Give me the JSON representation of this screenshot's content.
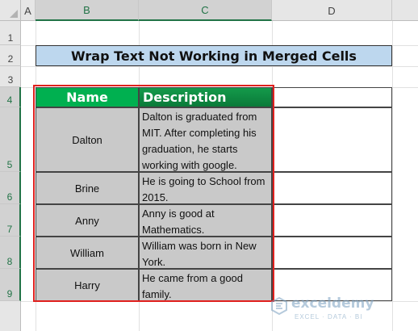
{
  "columns": [
    "A",
    "B",
    "C",
    "D"
  ],
  "rows": [
    "1",
    "2",
    "3",
    "4",
    "5",
    "6",
    "7",
    "8",
    "9"
  ],
  "title": "Wrap Text Not Working in Merged Cells",
  "table": {
    "headers": {
      "name": "Name",
      "description": "Description"
    },
    "rows": [
      {
        "name": "Dalton",
        "description": "Dalton is graduated from MIT. After completing his graduation, he starts working with google."
      },
      {
        "name": "Brine",
        "description": "He is going to School from 2015."
      },
      {
        "name": "Anny",
        "description": "Anny is good at Mathematics."
      },
      {
        "name": "William",
        "description": "William was born in New York."
      },
      {
        "name": "Harry",
        "description": "He came from a good family."
      }
    ]
  },
  "watermark": {
    "brand": "exceldemy",
    "tagline": "EXCEL · DATA · BI"
  },
  "colors": {
    "header_green": "#00b050",
    "title_fill": "#bdd7ee",
    "cell_gray": "#c9c9c9",
    "highlight_red": "#e0201e",
    "excel_green": "#217346"
  }
}
